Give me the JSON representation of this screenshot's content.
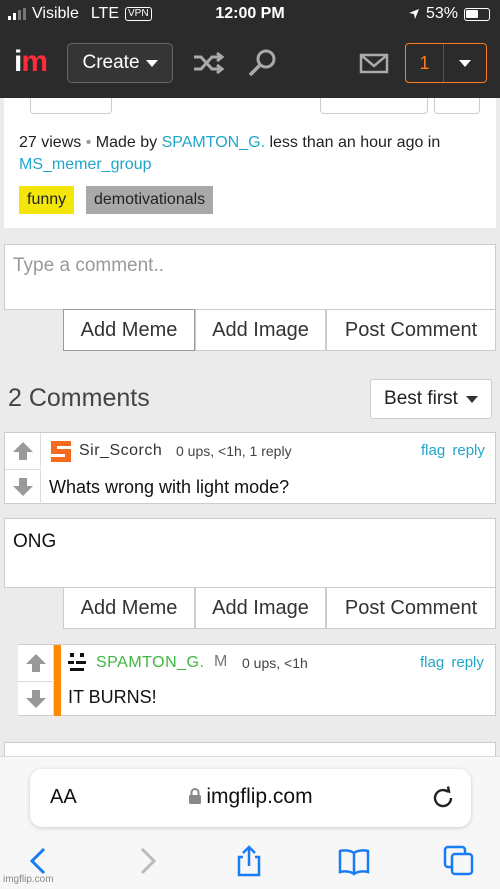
{
  "status": {
    "carrier": "Visible",
    "network": "LTE",
    "vpn": "VPN",
    "time": "12:00 PM",
    "battery": "53%"
  },
  "header": {
    "logo": "im",
    "create_label": "Create",
    "notification_count": "1"
  },
  "post": {
    "views": "27 views",
    "made_by_prefix": "Made by",
    "author": "SPAMTON_G.",
    "time_text": "less than an hour ago in",
    "stream": "MS_memer_group",
    "tags": [
      {
        "label": "funny",
        "color": "#f3e60a"
      },
      {
        "label": "demotivationals",
        "color": "#a9a9a9"
      }
    ]
  },
  "comment_form": {
    "placeholder": "Type a comment..",
    "buttons": {
      "add_meme": "Add Meme",
      "add_image": "Add Image",
      "post_comment": "Post Comment"
    }
  },
  "comments_section": {
    "heading": "2 Comments",
    "sort_label": "Best first"
  },
  "comments": [
    {
      "user": "Sir_Scorch",
      "meta": "0 ups, <1h, 1 reply",
      "flag": "flag",
      "reply": "reply",
      "text": "Whats wrong with light mode?",
      "user_color": "#333333"
    },
    {
      "user": "SPAMTON_G.",
      "badge": "M",
      "meta": "0 ups, <1h",
      "flag": "flag",
      "reply": "reply",
      "text": "IT BURNS!",
      "user_color": "#3fb63f"
    }
  ],
  "reply_form": {
    "value": "ONG",
    "buttons": {
      "add_meme": "Add Meme",
      "add_image": "Add Image",
      "post_comment": "Post Comment"
    }
  },
  "browser": {
    "aa_label": "AA",
    "url": "imgflip.com"
  },
  "watermark": "imgflip.com"
}
